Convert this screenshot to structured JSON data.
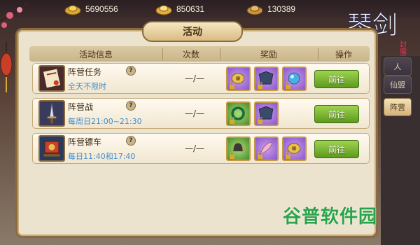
{
  "currencies": [
    {
      "icon": "gold-ingot-icon",
      "value": "5690556"
    },
    {
      "icon": "silver-ingot-icon",
      "value": "850631"
    },
    {
      "icon": "bound-ingot-icon",
      "value": "130389"
    }
  ],
  "logo": {
    "main": "琴剑",
    "sub": "封魔录"
  },
  "panel": {
    "title": "活动"
  },
  "table": {
    "headers": {
      "info": "活动信息",
      "count": "次数",
      "reward": "奖励",
      "op": "操作"
    },
    "rows": [
      {
        "name": "阵营任务",
        "time": "全天不限时",
        "count": "—/—",
        "button": "前往"
      },
      {
        "name": "阵营战",
        "time": "每周日21:00~21:30",
        "count": "—/—",
        "button": "前往"
      },
      {
        "name": "阵营镖车",
        "time": "每日11:40和17:40",
        "count": "—/—",
        "button": "前往"
      }
    ]
  },
  "side_tabs": [
    {
      "label": "人"
    },
    {
      "label": "仙盟"
    },
    {
      "label": "阵营"
    }
  ],
  "help_glyph": "?",
  "watermark": {
    "text": "谷普软件园",
    "box_glyph": "园"
  },
  "colors": {
    "panel_bg": "#ece3cf",
    "panel_border": "#8a6a3e",
    "time_text": "#3f8fd0",
    "go_button": "#7cb535",
    "reward_purple": "#8a55c8",
    "reward_green": "#4a8a2a",
    "watermark": "#2aa34a"
  }
}
